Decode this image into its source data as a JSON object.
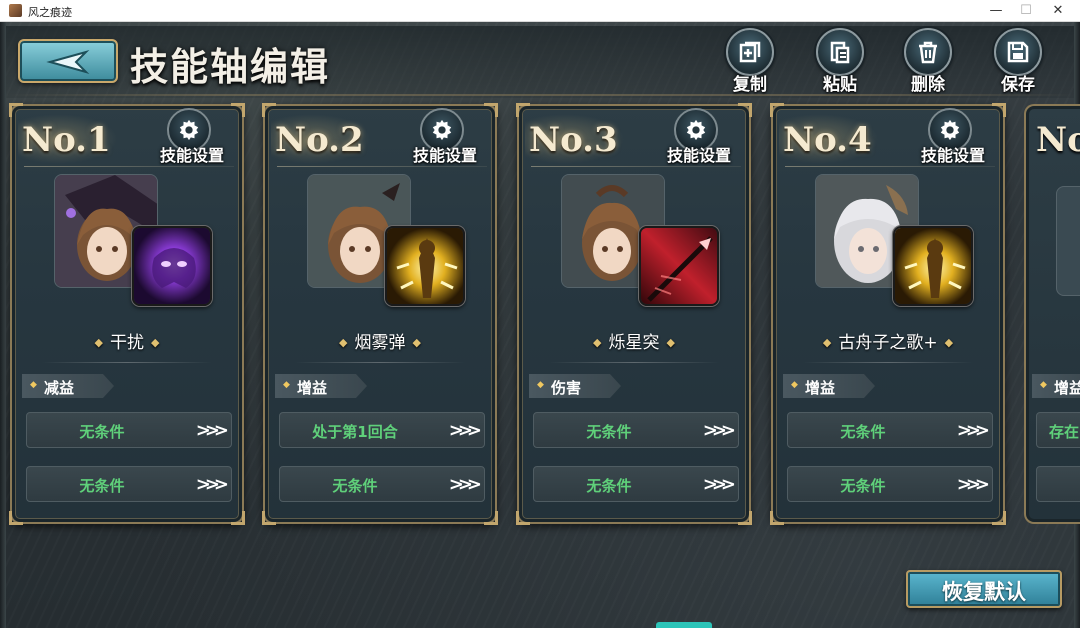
{
  "window": {
    "title": "风之痕迹",
    "minimize": "—",
    "maximize": "☐",
    "close": "✕"
  },
  "header": {
    "title": "技能轴编辑"
  },
  "toolbar": [
    {
      "label": "复制",
      "icon": "copy-icon"
    },
    {
      "label": "粘贴",
      "icon": "paste-icon"
    },
    {
      "label": "删除",
      "icon": "trash-icon"
    },
    {
      "label": "保存",
      "icon": "save-icon"
    }
  ],
  "settings_label": "技能设置",
  "cards": [
    {
      "number": "No.1",
      "skill_name": "干扰",
      "tag": "减益",
      "conditions": [
        "无条件",
        "无条件"
      ],
      "skill_color": "#8a3bd6"
    },
    {
      "number": "No.2",
      "skill_name": "烟雾弹",
      "tag": "增益",
      "conditions": [
        "处于第1回合",
        "无条件"
      ],
      "skill_color": "#e2b020"
    },
    {
      "number": "No.3",
      "skill_name": "烁星突",
      "tag": "伤害",
      "conditions": [
        "无条件",
        "无条件"
      ],
      "skill_color": "#c0202c"
    },
    {
      "number": "No.4",
      "skill_name": "古舟子之歌+",
      "tag": "增益",
      "conditions": [
        "无条件",
        "无条件"
      ],
      "skill_color": "#e2b020"
    }
  ],
  "partial_card": {
    "number": "No",
    "tag": "增益",
    "conditions": [
      "存在"
    ]
  },
  "restore_button": "恢复默认",
  "colors": {
    "condition_text": "#5fd07a",
    "accent_gold": "#c2a66d",
    "button_teal": "#3c8a9b"
  }
}
